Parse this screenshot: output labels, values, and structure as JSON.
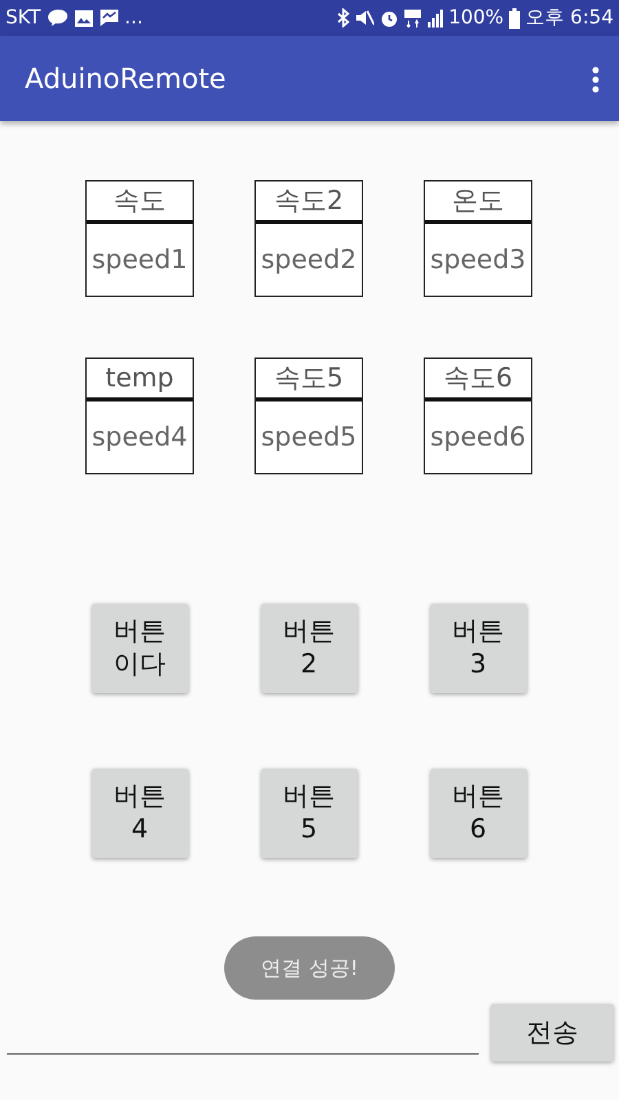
{
  "status_bar": {
    "carrier": "SKT",
    "more": "...",
    "battery": "100%",
    "time": "오후 6:54"
  },
  "app_bar": {
    "title": "AduinoRemote"
  },
  "readouts": [
    {
      "label": "속도",
      "value": "speed1"
    },
    {
      "label": "속도2",
      "value": "speed2"
    },
    {
      "label": "온도",
      "value": "speed3"
    },
    {
      "label": "temp",
      "value": "speed4"
    },
    {
      "label": "속도5",
      "value": "speed5"
    },
    {
      "label": "속도6",
      "value": "speed6"
    }
  ],
  "buttons": [
    "버튼\n이다",
    "버튼\n2",
    "버튼\n3",
    "버튼\n4",
    "버튼\n5",
    "버튼\n6"
  ],
  "toast": "연결 성공!",
  "send_button": "전송"
}
